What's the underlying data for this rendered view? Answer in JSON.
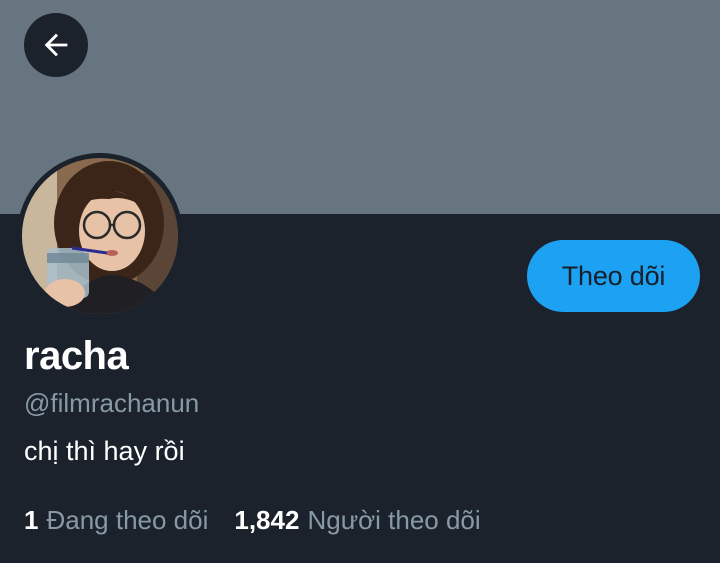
{
  "profile": {
    "display_name": "racha",
    "handle": "@filmrachanun",
    "bio": "chị thì hay rồi",
    "follow_label": "Theo dõi"
  },
  "stats": {
    "following_count": "1",
    "following_label": "Đang theo dõi",
    "followers_count": "1,842",
    "followers_label": "Người theo dõi"
  },
  "icons": {
    "back": "arrow-left-icon",
    "avatar": "profile-photo"
  },
  "colors": {
    "banner": "#66757f",
    "background": "#1b222b",
    "accent": "#1da1f2",
    "secondary_text": "#8899a6"
  }
}
